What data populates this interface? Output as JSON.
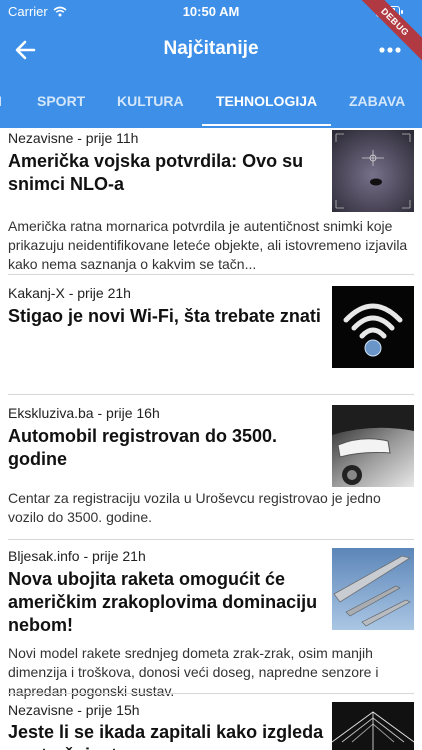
{
  "status_bar": {
    "carrier": "Carrier",
    "time": "10:50 AM",
    "battery_level": 0.9
  },
  "debug_banner": "DEBUG",
  "header": {
    "title": "Najčitanije",
    "back_icon": "arrow-left-icon",
    "more_icon": "more-horizontal-icon"
  },
  "tabs": [
    {
      "label": "I",
      "active": false
    },
    {
      "label": "SPORT",
      "active": false
    },
    {
      "label": "KULTURA",
      "active": false
    },
    {
      "label": "TEHNOLOGIJA",
      "active": true
    },
    {
      "label": "ZABAVA",
      "active": false
    }
  ],
  "colors": {
    "app_bar": "#3d8fe8",
    "debug": "#b13a42"
  },
  "articles": [
    {
      "source": "Nezavisne - prije 11h",
      "headline": "Američka vojska potvrdila: Ovo su snimci NLO-a",
      "description": "Američka ratna mornarica potvrdila je autentičnost snimki koje prikazuju neidentifikovane leteće objekte, ali istovremeno izjavila kako nema saznanja o kakvim se tačn...",
      "image": "ufo-footage-thumbnail"
    },
    {
      "source": "Kakanj-X - prije 21h",
      "headline": "Stigao je novi Wi-Fi, šta trebate znati",
      "description": "",
      "image": "wifi-logo-thumbnail"
    },
    {
      "source": "Ekskluziva.ba - prije 16h",
      "headline": "Automobil registrovan do 3500. godine",
      "description": "Centar za registraciju vozila u Uroševcu registrovao je jedno vozilo do 3500. godine.",
      "image": "car-headlight-thumbnail"
    },
    {
      "source": "Bljesak.info - prije 21h",
      "headline": "Nova ubojita raketa omogućit će američkim zrakoplovima dominaciju nebom!",
      "description": "Novi model rakete srednjeg dometa zrak-zrak, osim manjih dimenzija i troškova, donosi veći doseg, napredne senzore i napredan pogonski sustav.",
      "image": "missile-thumbnail"
    },
    {
      "source": "Nezavisne - prije 15h",
      "headline": "Jeste li se ikada zapitali kako izgleda unutrašnjost",
      "description": "",
      "image": "tech-interior-thumbnail"
    }
  ]
}
